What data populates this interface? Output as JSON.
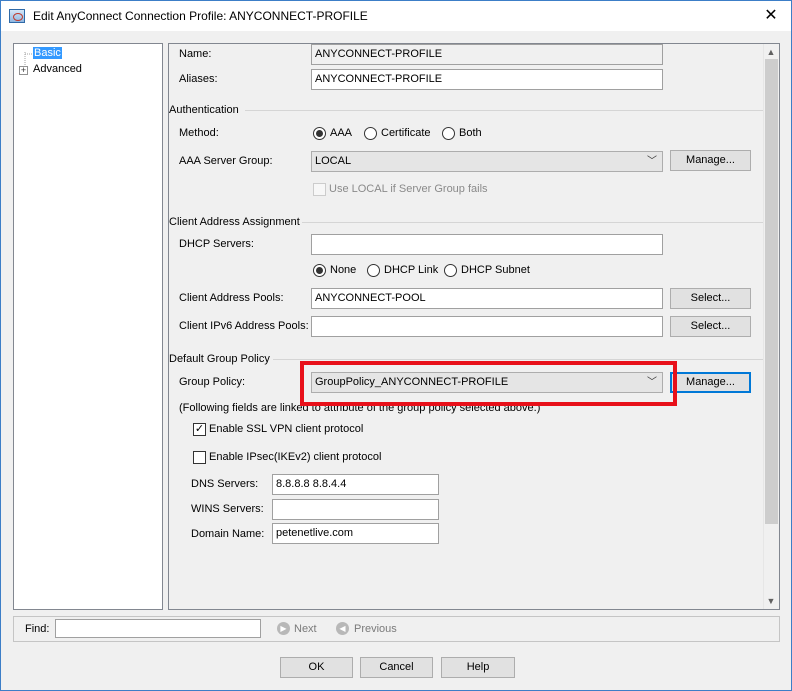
{
  "window": {
    "title": "Edit AnyConnect Connection Profile: ANYCONNECT-PROFILE",
    "close_glyph": "✕"
  },
  "tree": {
    "items": [
      {
        "label": "Basic",
        "selected": true
      },
      {
        "label": "Advanced",
        "expander": "+"
      }
    ]
  },
  "basic": {
    "name_label": "Name:",
    "name_value": "ANYCONNECT-PROFILE",
    "aliases_label": "Aliases:",
    "aliases_value": "ANYCONNECT-PROFILE"
  },
  "authentication": {
    "group_label": "Authentication",
    "method_label": "Method:",
    "methods": [
      {
        "label": "AAA",
        "selected": true
      },
      {
        "label": "Certificate",
        "selected": false
      },
      {
        "label": "Both",
        "selected": false
      }
    ],
    "aaa_server_group_label": "AAA Server Group:",
    "aaa_server_group_value": "LOCAL",
    "manage_label": "Manage...",
    "use_local_label": "Use LOCAL if Server Group fails"
  },
  "client_address": {
    "group_label": "Client Address Assignment",
    "dhcp_servers_label": "DHCP Servers:",
    "dhcp_servers_value": "",
    "dhcp_options": [
      {
        "label": "None",
        "selected": true
      },
      {
        "label": "DHCP Link",
        "selected": false
      },
      {
        "label": "DHCP Subnet",
        "selected": false
      }
    ],
    "pools_label": "Client Address Pools:",
    "pools_value": "ANYCONNECT-POOL",
    "ipv6_pools_label": "Client IPv6 Address Pools:",
    "ipv6_pools_value": "",
    "select_label": "Select..."
  },
  "group_policy": {
    "group_label": "Default Group Policy",
    "policy_label": "Group Policy:",
    "policy_value": "GroupPolicy_ANYCONNECT-PROFILE",
    "manage_label": "Manage...",
    "note": "(Following fields are linked to attribute of the group policy selected above.)",
    "ssl_label": "Enable SSL VPN client protocol",
    "ssl_checked": true,
    "ipsec_label": "Enable IPsec(IKEv2) client protocol",
    "ipsec_checked": false,
    "dns_label": "DNS Servers:",
    "dns_value": "8.8.8.8 8.8.4.4",
    "wins_label": "WINS Servers:",
    "wins_value": "",
    "domain_label": "Domain Name:",
    "domain_value": "petenetlive.com"
  },
  "find": {
    "label": "Find:",
    "value": "",
    "next_label": "Next",
    "previous_label": "Previous"
  },
  "buttons": {
    "ok": "OK",
    "cancel": "Cancel",
    "help": "Help"
  },
  "colors": {
    "highlight": "#e8101a",
    "selection": "#3399ff",
    "focus": "#0078d7"
  }
}
